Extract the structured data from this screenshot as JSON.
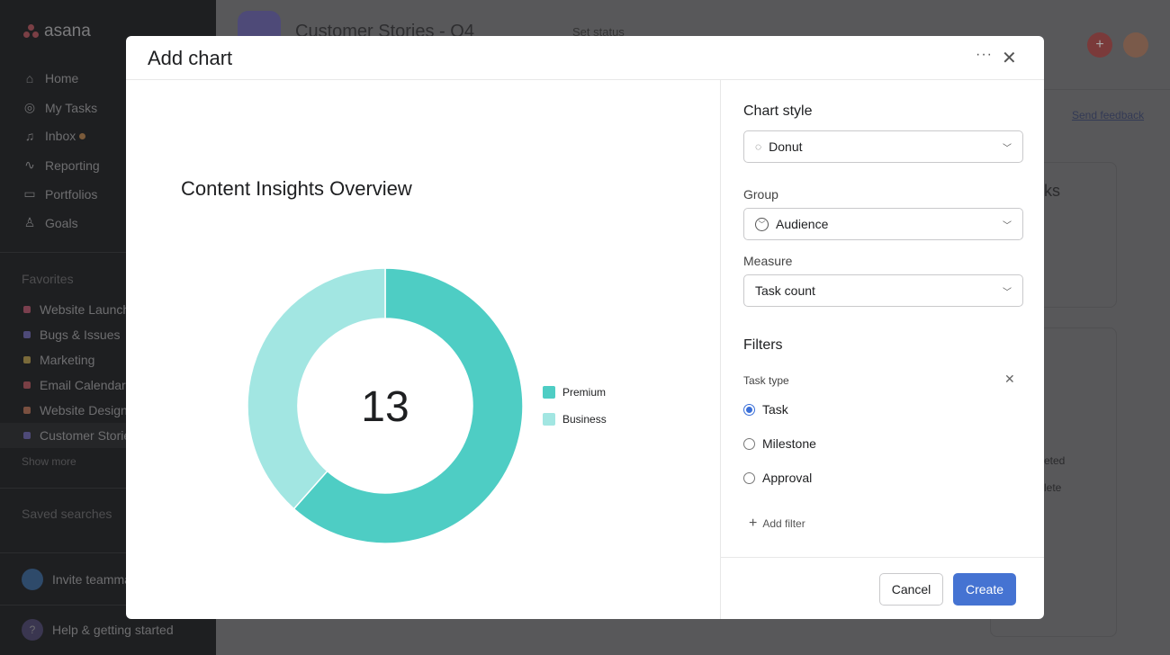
{
  "sidebar": {
    "logo": "asana",
    "nav": [
      {
        "label": "Home",
        "icon": "home-icon"
      },
      {
        "label": "My Tasks",
        "icon": "check-circle-icon"
      },
      {
        "label": "Inbox",
        "icon": "bell-icon"
      },
      {
        "label": "Reporting",
        "icon": "chart-line-icon"
      },
      {
        "label": "Portfolios",
        "icon": "folder-icon"
      },
      {
        "label": "Goals",
        "icon": "person-icon"
      }
    ],
    "favorites_title": "Favorites",
    "favorites": [
      {
        "label": "Website Launch",
        "color": "#7a3f4e"
      },
      {
        "label": "Bugs & Issues",
        "color": "#4e4a78"
      },
      {
        "label": "Marketing",
        "color": "#7a6a3a"
      },
      {
        "label": "Email Calendar",
        "color": "#7a3f45"
      },
      {
        "label": "Website Design",
        "color": "#7a5040"
      },
      {
        "label": "Customer Stories",
        "color": "#4e4a78"
      }
    ],
    "show_more": "Show more",
    "saved_searches": "Saved searches",
    "invite": "Invite teammates",
    "help": "Help & getting started"
  },
  "header": {
    "project_title": "Customer Stories - Q4",
    "set_status": "Set status",
    "send_feedback": "Send feedback"
  },
  "background": {
    "card_title_fragment": "ks",
    "list_fragments": [
      "eted",
      "lete"
    ]
  },
  "modal": {
    "title": "Add chart",
    "chart": {
      "title": "Content Insights Overview",
      "center_value": "13"
    },
    "panel": {
      "chart_style_title": "Chart style",
      "chart_style_value": "Donut",
      "group_label": "Group",
      "group_value": "Audience",
      "measure_label": "Measure",
      "measure_value": "Task count",
      "filters_title": "Filters",
      "task_type_label": "Task type",
      "task_type_options": [
        {
          "label": "Task",
          "selected": true
        },
        {
          "label": "Milestone",
          "selected": false
        },
        {
          "label": "Approval",
          "selected": false
        }
      ],
      "add_filter": "Add filter"
    },
    "cancel": "Cancel",
    "create": "Create",
    "accent": "#4573d2"
  },
  "chart_data": {
    "type": "pie",
    "variant": "donut",
    "title": "Content Insights Overview",
    "total": 13,
    "categories": [
      "Premium",
      "Business"
    ],
    "values": [
      8,
      5
    ],
    "colors": [
      "#4ecdc4",
      "#a2e6e2"
    ],
    "legend": "right"
  }
}
